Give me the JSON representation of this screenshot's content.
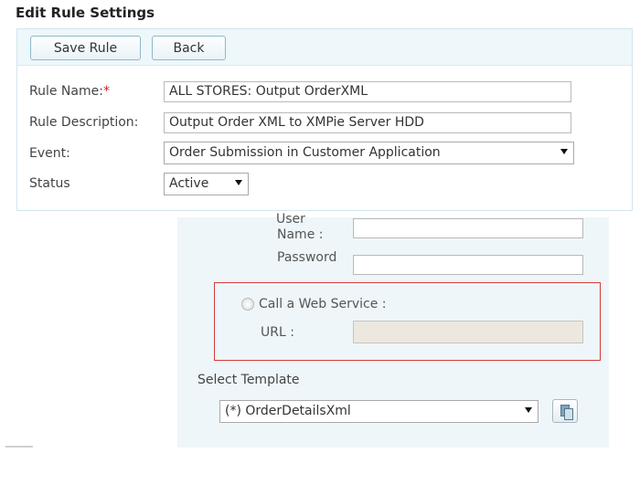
{
  "page_title": "Edit Rule Settings",
  "toolbar": {
    "save_label": "Save Rule",
    "back_label": "Back"
  },
  "form": {
    "rule_name_label": "Rule Name:",
    "required_mark": "*",
    "rule_name_value": "ALL STORES: Output OrderXML",
    "rule_description_label": "Rule Description:",
    "rule_description_value": "Output Order XML to XMPie Server HDD",
    "event_label": "Event:",
    "event_value": "Order Submission in Customer Application",
    "status_label": "Status",
    "status_value": "Active"
  },
  "credentials": {
    "user_label_line1": "User",
    "user_label_line2": "Name :",
    "user_value": "",
    "password_label": "Password",
    "password_value": ""
  },
  "web_service": {
    "radio_label": "Call a Web Service :",
    "url_label": "URL :",
    "url_value": ""
  },
  "template": {
    "label": "Select Template",
    "value": "(*) OrderDetailsXml"
  },
  "icons": {
    "dropdown": "chevron-down-icon",
    "copy": "copy-icon"
  },
  "colors": {
    "panel_bg": "#eef6f9",
    "highlight_box": "#d53b3b",
    "required": "#d02020"
  }
}
